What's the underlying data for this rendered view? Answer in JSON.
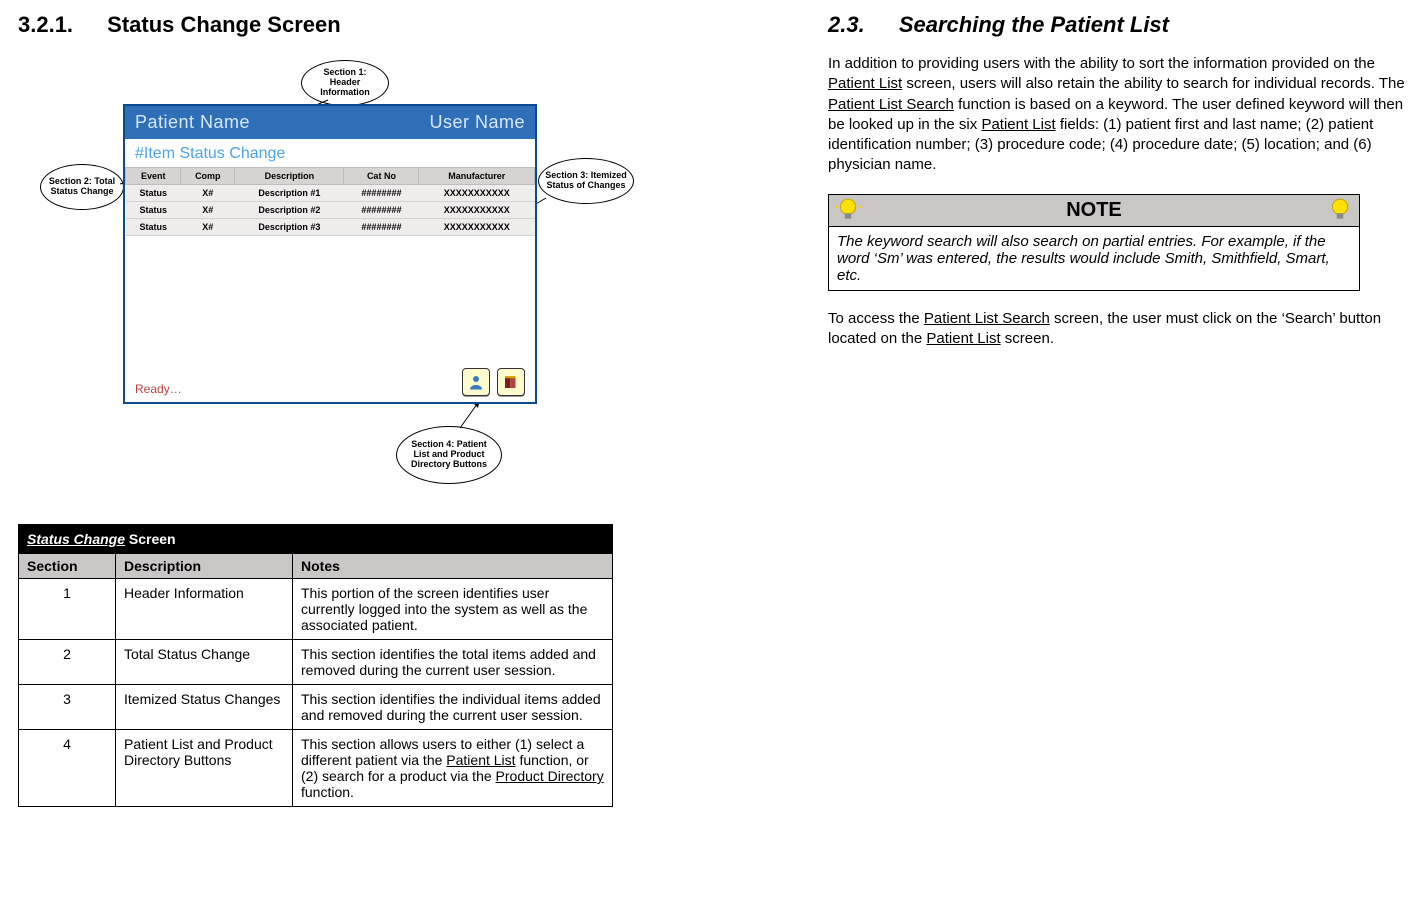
{
  "left": {
    "heading_num": "3.2.1.",
    "heading_text": "Status Change Screen",
    "mock": {
      "header_left": "Patient Name",
      "header_right": "User Name",
      "subheader": "#Item Status Change",
      "cols": [
        "Event",
        "Comp",
        "Description",
        "Cat No",
        "Manufacturer"
      ],
      "rows": [
        [
          "Status",
          "X#",
          "Description #1",
          "########",
          "XXXXXXXXXXX"
        ],
        [
          "Status",
          "X#",
          "Description #2",
          "########",
          "XXXXXXXXXXX"
        ],
        [
          "Status",
          "X#",
          "Description #3",
          "########",
          "XXXXXXXXXXX"
        ]
      ],
      "status_text": "Ready…"
    },
    "callouts": {
      "s1": "Section 1: Header Information",
      "s2": "Section 2: Total Status Change",
      "s3": "Section 3: Itemized Status of Changes",
      "s4": "Section 4: Patient List and Product Directory Buttons"
    },
    "table_title_italic": "Status Change",
    "table_title_plain": " Screen",
    "table_head": [
      "Section",
      "Description",
      "Notes"
    ],
    "table_rows": [
      {
        "n": "1",
        "d": "Header Information",
        "notes": "This portion of the screen identifies user currently logged into the system as well as the associated patient."
      },
      {
        "n": "2",
        "d": "Total Status Change",
        "notes": "This section identifies the total items added and removed during the current user session."
      },
      {
        "n": "3",
        "d": "Itemized Status Changes",
        "notes": "This section identifies the individual items added and removed during the current user session."
      },
      {
        "n": "4",
        "d": "Patient List and Product Directory Buttons",
        "notes_html": "This section allows users to either (1) select a different patient via the <span class='u'>Patient List</span> function, or (2) search for a product via the <span class='u'>Product Directory</span> function."
      }
    ]
  },
  "right": {
    "heading_num": "2.3.",
    "heading_text": "Searching the Patient List",
    "para1_html": "In addition to providing users with the ability to sort the information provided on the <span class='u'>Patient List</span> screen, users will also retain the ability to search for individual records.  The <span class='u'>Patient List Search</span> function is based on a keyword.  The user defined keyword will then be looked up in the six <span class='u'>Patient List</span> fields: (1) patient first and last name; (2) patient identification number; (3) procedure code; (4) procedure date; (5) location; and (6) physician name.",
    "note_title": "NOTE",
    "note_body": "The keyword search will also search on partial entries.  For example, if the word ‘Sm’ was entered, the results would include Smith, Smithfield, Smart, etc.",
    "para2_html": "To access the <span class='u'>Patient List Search</span> screen, the user must click on the ‘Search’ button located on the <span class='u'>Patient List</span> screen."
  }
}
